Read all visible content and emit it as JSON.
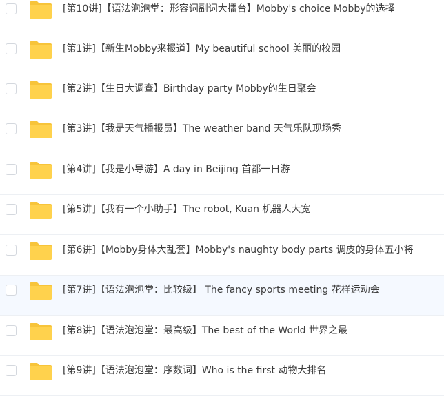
{
  "file_list": {
    "items": [
      {
        "name": "[第10讲]【语法泡泡堂：形容词副词大擂台】Mobby's choice Mobby的选择",
        "icon": "folder-icon"
      },
      {
        "name": "[第1讲]【新生Mobby来报道】My beautiful school 美丽的校园",
        "icon": "folder-icon"
      },
      {
        "name": "[第2讲]【生日大调查】Birthday party Mobby的生日聚会",
        "icon": "folder-icon"
      },
      {
        "name": "[第3讲]【我是天气播报员】The weather band 天气乐队现场秀",
        "icon": "folder-icon"
      },
      {
        "name": "[第4讲]【我是小导游】A day in Beijing 首都一日游",
        "icon": "folder-icon"
      },
      {
        "name": "[第5讲]【我有一个小助手】The robot, Kuan 机器人大宽",
        "icon": "folder-icon"
      },
      {
        "name": "[第6讲]【Mobby身体大乱套】Mobby's naughty body parts 调皮的身体五小将",
        "icon": "folder-icon"
      },
      {
        "name": "[第7讲]【语法泡泡堂：比较级】 The fancy sports meeting 花样运动会",
        "icon": "folder-icon"
      },
      {
        "name": "[第8讲]【语法泡泡堂：最高级】The best of the World 世界之最",
        "icon": "folder-icon"
      },
      {
        "name": "[第9讲]【语法泡泡堂：序数词】Who is the first 动物大排名",
        "icon": "folder-icon"
      }
    ],
    "hover_index": 7
  },
  "colors": {
    "folder": "#ffd24d",
    "folder_back": "#f7c43a",
    "text": "#3d3d3d",
    "hover_background": "#f5f9ff",
    "divider": "#edf0f4"
  }
}
